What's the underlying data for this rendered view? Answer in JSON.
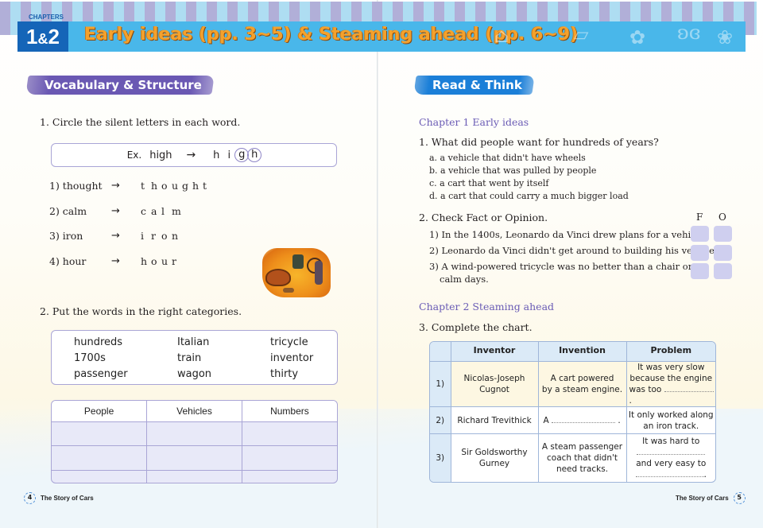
{
  "header": {
    "chapters_label": "CHAPTERS",
    "chapter_number_a": "1",
    "chapter_number_amp": "&",
    "chapter_number_b": "2",
    "title": "Early ideas (pp. 3~5) & Steaming ahead (pp. 6~9)",
    "colors": {
      "banner": "#49b7ea",
      "chapter_box": "#1565b8",
      "title": "#f4a12c"
    }
  },
  "left_page": {
    "section_tag": "Vocabulary & Structure",
    "q1": {
      "prompt": "1. Circle the silent letters in each word.",
      "example": {
        "label": "Ex.",
        "word": "high",
        "arrow": "→",
        "letters": [
          "h",
          "i",
          "g",
          "h"
        ],
        "circled": [
          2,
          3
        ]
      },
      "items": [
        {
          "word": "1) thought",
          "arrow": "→",
          "letters": [
            "t",
            "h",
            "o",
            "u",
            "g",
            "h",
            "t"
          ]
        },
        {
          "word": "2) calm",
          "arrow": "→",
          "letters": [
            "c",
            "a",
            "l",
            "m"
          ]
        },
        {
          "word": "3) iron",
          "arrow": "→",
          "letters": [
            "i",
            "r",
            "o",
            "n"
          ]
        },
        {
          "word": "4) hour",
          "arrow": "→",
          "letters": [
            "h",
            "o",
            "u",
            "r"
          ]
        }
      ]
    },
    "illustration": "steam-carriage-illustration",
    "q2": {
      "prompt": "2. Put the words in the right categories.",
      "word_bank": [
        [
          "hundreds",
          "Italian",
          "tricycle"
        ],
        [
          "1700s",
          "train",
          "inventor"
        ],
        [
          "passenger",
          "wagon",
          "thirty"
        ]
      ],
      "table_headers": [
        "People",
        "Vehicles",
        "Numbers"
      ],
      "table_rows": [
        [
          "",
          "",
          ""
        ],
        [
          "",
          "",
          ""
        ],
        [
          "",
          "",
          ""
        ]
      ]
    },
    "footer": {
      "page_number": "4",
      "book_title": "The Story of Cars"
    }
  },
  "right_page": {
    "section_tag": "Read & Think",
    "chapter1_heading": "Chapter 1 Early ideas",
    "q1": {
      "prompt": "1. What did people want for hundreds of years?",
      "options": [
        "a. a vehicle that didn't have wheels",
        "b. a vehicle that was pulled by people",
        "c. a cart that went by itself",
        "d. a cart that could carry a much bigger load"
      ]
    },
    "q2": {
      "prompt": "2. Check Fact or Opinion.",
      "col_f": "F",
      "col_o": "O",
      "statements": [
        "1) In the 1400s, Leonardo da Vinci drew plans for a vehicle.",
        "2) Leonardo da Vinci didn't get around to building his vehicle.",
        "3) A wind-powered tricycle was no better than a chair on",
        "calm days."
      ]
    },
    "chapter2_heading": "Chapter 2 Steaming ahead",
    "q3": {
      "prompt": "3. Complete the chart.",
      "headers": [
        "",
        "Inventor",
        "Invention",
        "Problem"
      ],
      "rows": [
        {
          "num": "1)",
          "inventor": [
            "Nicolas-Joseph",
            "Cugnot"
          ],
          "invention": [
            "A cart powered",
            "by a steam engine."
          ],
          "problem": [
            "It was very slow",
            "because the engine",
            "was too",
            "."
          ]
        },
        {
          "num": "2)",
          "inventor": [
            "Richard Trevithick"
          ],
          "invention": [
            "A",
            "."
          ],
          "problem": [
            "It only worked along",
            "an iron track."
          ]
        },
        {
          "num": "3)",
          "inventor": [
            "Sir Goldsworthy",
            "Gurney"
          ],
          "invention": [
            "A steam passenger",
            "coach that didn't",
            "need tracks."
          ],
          "problem": [
            "It was hard to",
            "and very easy to",
            "."
          ]
        }
      ]
    },
    "footer": {
      "page_number": "5",
      "book_title": "The Story of Cars"
    }
  }
}
